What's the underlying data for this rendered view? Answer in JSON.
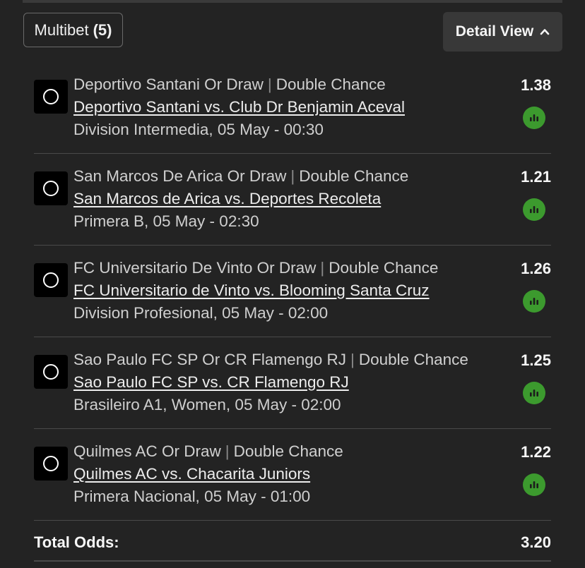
{
  "header": {
    "multibet_label": "Multibet",
    "multibet_count": "(5)",
    "detail_view_label": "Detail View"
  },
  "bets": [
    {
      "selection": "Deportivo Santani Or Draw",
      "market": "Double Chance",
      "match": "Deportivo Santani vs. Club Dr Benjamin Aceval",
      "league_time": "Division Intermedia, 05 May - 00:30",
      "odds": "1.38"
    },
    {
      "selection": "San Marcos De Arica Or Draw",
      "market": "Double Chance",
      "match": "San Marcos de Arica vs. Deportes Recoleta",
      "league_time": "Primera B, 05 May - 02:30",
      "odds": "1.21"
    },
    {
      "selection": "FC Universitario De Vinto Or Draw",
      "market": "Double Chance",
      "match": "FC Universitario de Vinto vs. Blooming Santa Cruz",
      "league_time": "Division Profesional, 05 May - 02:00",
      "odds": "1.26"
    },
    {
      "selection": "Sao Paulo FC SP Or CR Flamengo RJ",
      "market": "Double Chance",
      "match": "Sao Paulo FC SP vs. CR Flamengo RJ",
      "league_time": "Brasileiro A1, Women, 05 May - 02:00",
      "odds": "1.25"
    },
    {
      "selection": "Quilmes AC Or Draw",
      "market": "Double Chance",
      "match": "Quilmes AC vs. Chacarita Juniors",
      "league_time": "Primera Nacional, 05 May - 01:00",
      "odds": "1.22"
    }
  ],
  "total": {
    "label": "Total Odds:",
    "value": "3.20"
  },
  "icons": {
    "bet_marker": "ring-icon",
    "stats": "bar-chart-icon",
    "detail_toggle": "chevron-up-icon"
  },
  "colors": {
    "background": "#232323",
    "stats_green": "#3c9a2e",
    "text": "#e6e6e6"
  }
}
